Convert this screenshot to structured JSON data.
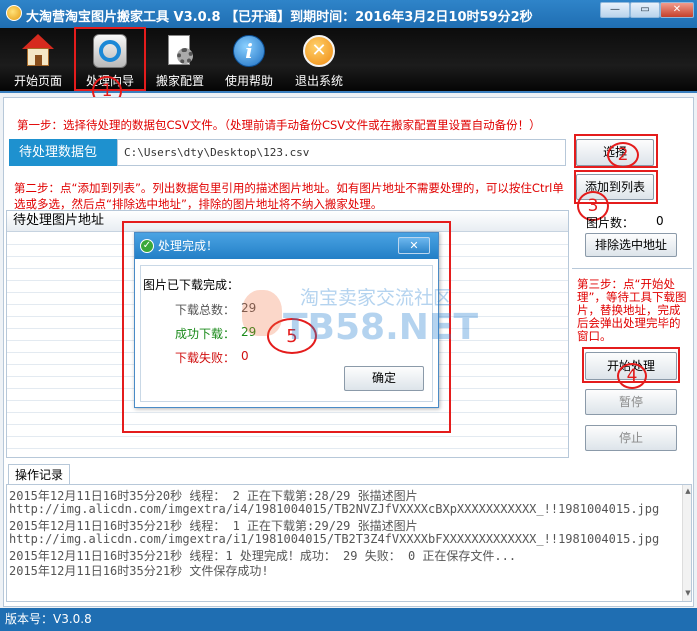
{
  "window": {
    "title": "大淘营淘宝图片搬家工具 V3.0.8 【已开通】到期时间：2016年3月2日10时59分2秒",
    "minimize": "—",
    "maximize": "▭",
    "close": "✕"
  },
  "toolbar": {
    "items": [
      {
        "label": "开始页面",
        "icon": "home-icon"
      },
      {
        "label": "处理向导",
        "icon": "wizard-icon"
      },
      {
        "label": "搬家配置",
        "icon": "settings-icon"
      },
      {
        "label": "使用帮助",
        "icon": "info-icon"
      },
      {
        "label": "退出系统",
        "icon": "exit-icon"
      }
    ],
    "info_glyph": "i",
    "exit_glyph": "✕"
  },
  "step1": {
    "text": "第一步：选择待处理的数据包CSV文件。（处理前请手动备份CSV文件或在搬家配置里设置自动备份！）",
    "field_label": "待处理数据包",
    "field_value": "C:\\Users\\dty\\Desktop\\123.csv",
    "select_button": "选择"
  },
  "step2": {
    "text": "第二步：点“添加到列表”。列出数据包里引用的描述图片地址。如有图片地址不需要处理的，可以按住Ctrl单选或多选，然后点“排除选中地址”，排除的图片地址将不纳入搬家处理。",
    "add_button": "添加到列表"
  },
  "image_list": {
    "header": "待处理图片地址"
  },
  "side": {
    "count_label": "图片数：",
    "count_value": "0",
    "exclude_button": "排除选中地址",
    "step3_text": "第三步：点“开始处理”，等待工具下载图片，替换地址，完成后会弹出处理完毕的窗口。",
    "start_button": "开始处理",
    "pause_button": "暂停",
    "stop_button": "停止"
  },
  "annotations": {
    "n1": "1",
    "n2": "2",
    "n3": "3",
    "n4": "4",
    "n5": "5"
  },
  "dialog": {
    "title": "处理完成！",
    "check_glyph": "✓",
    "close_glyph": "✕",
    "heading": "图片已下载完成：",
    "total_label": "下载总数：",
    "total_value": "29",
    "success_label": "成功下载：",
    "success_value": "29",
    "fail_label": "下载失败：",
    "fail_value": "0",
    "ok_button": "确定"
  },
  "watermark": {
    "line1": "淘宝卖家交流社区",
    "line2": "TB58.NET"
  },
  "log": {
    "tab": "操作记录",
    "lines": [
      "2015年12月11日16时35分20秒 线程： 2  正在下载第:28/29 张描述图片",
      "http://img.alicdn.com/imgextra/i4/1981004015/TB2NVZJfVXXXXcBXpXXXXXXXXXXX_!!1981004015.jpg",
      "2015年12月11日16时35分21秒 线程： 1  正在下载第:29/29 张描述图片",
      "http://img.alicdn.com/imgextra/i1/1981004015/TB2T3Z4fVXXXXbFXXXXXXXXXXXXX_!!1981004015.jpg",
      "2015年12月11日16时35分21秒 线程：1 处理完成！成功： 29 失败： 0 正在保存文件...",
      "2015年12月11日16时35分21秒 文件保存成功!"
    ],
    "scroll_up": "▲",
    "scroll_down": "▼"
  },
  "status": {
    "version": "版本号：V3.0.8"
  }
}
